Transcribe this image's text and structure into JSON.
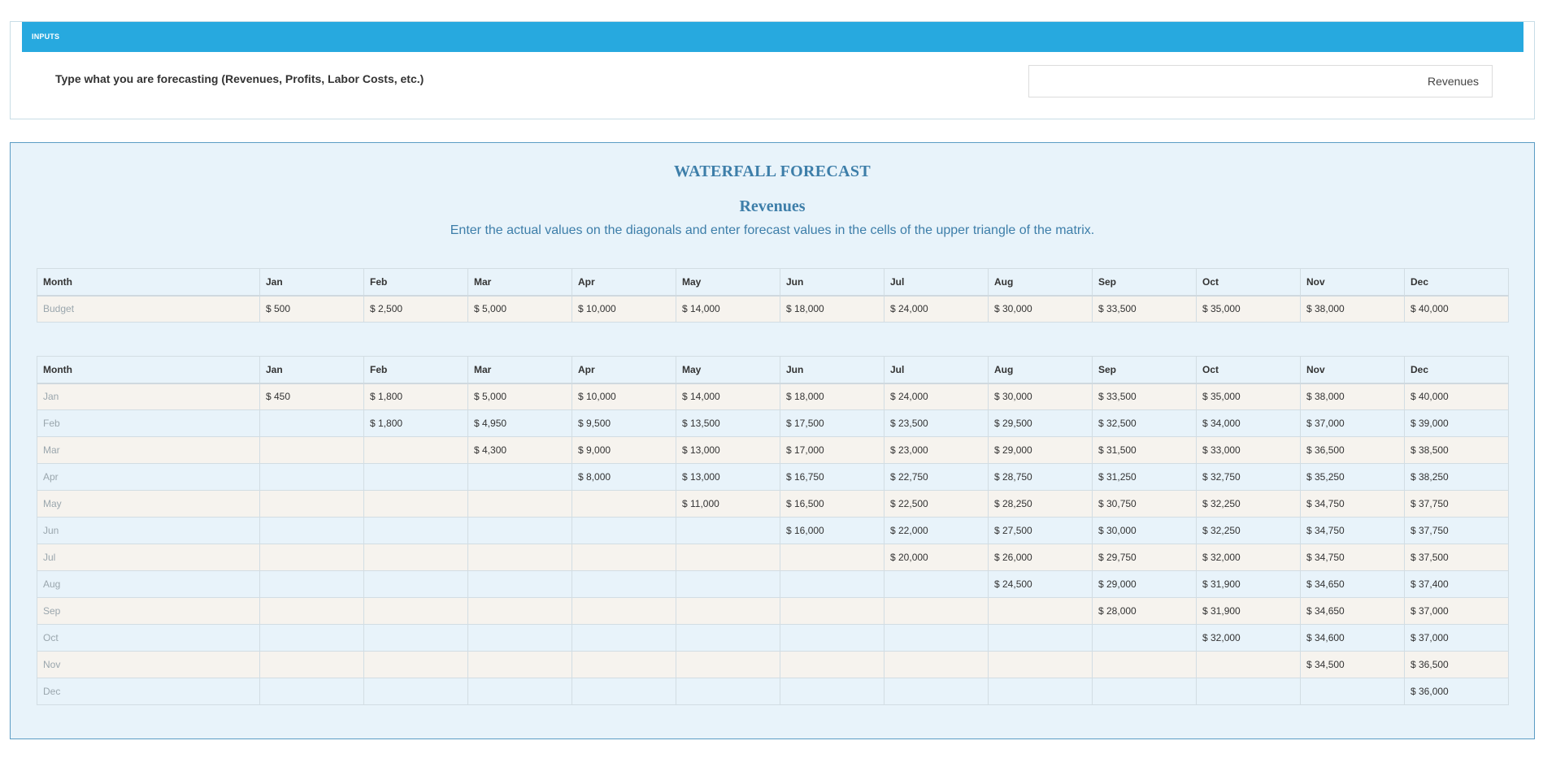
{
  "inputs": {
    "header": "INPUTS",
    "label": "Type what you are forecasting (Revenues, Profits, Labor Costs, etc.)",
    "value": "Revenues"
  },
  "forecast": {
    "title": "WATERFALL FORECAST",
    "subtitle": "Revenues",
    "instructions": "Enter the actual values on the diagonals and enter forecast values in the cells of the upper triangle of the matrix."
  },
  "budget_table": {
    "headers": [
      "Month",
      "Jan",
      "Feb",
      "Mar",
      "Apr",
      "May",
      "Jun",
      "Jul",
      "Aug",
      "Sep",
      "Oct",
      "Nov",
      "Dec"
    ],
    "rows": [
      [
        "Budget",
        "$ 500",
        "$ 2,500",
        "$ 5,000",
        "$ 10,000",
        "$ 14,000",
        "$ 18,000",
        "$ 24,000",
        "$ 30,000",
        "$ 33,500",
        "$ 35,000",
        "$ 38,000",
        "$ 40,000"
      ]
    ]
  },
  "matrix_table": {
    "headers": [
      "Month",
      "Jan",
      "Feb",
      "Mar",
      "Apr",
      "May",
      "Jun",
      "Jul",
      "Aug",
      "Sep",
      "Oct",
      "Nov",
      "Dec"
    ],
    "rows": [
      [
        "Jan",
        "$ 450",
        "$ 1,800",
        "$ 5,000",
        "$ 10,000",
        "$ 14,000",
        "$ 18,000",
        "$ 24,000",
        "$ 30,000",
        "$ 33,500",
        "$ 35,000",
        "$ 38,000",
        "$ 40,000"
      ],
      [
        "Feb",
        "",
        "$ 1,800",
        "$ 4,950",
        "$ 9,500",
        "$ 13,500",
        "$ 17,500",
        "$ 23,500",
        "$ 29,500",
        "$ 32,500",
        "$ 34,000",
        "$ 37,000",
        "$ 39,000"
      ],
      [
        "Mar",
        "",
        "",
        "$ 4,300",
        "$ 9,000",
        "$ 13,000",
        "$ 17,000",
        "$ 23,000",
        "$ 29,000",
        "$ 31,500",
        "$ 33,000",
        "$ 36,500",
        "$ 38,500"
      ],
      [
        "Apr",
        "",
        "",
        "",
        "$ 8,000",
        "$ 13,000",
        "$ 16,750",
        "$ 22,750",
        "$ 28,750",
        "$ 31,250",
        "$ 32,750",
        "$ 35,250",
        "$ 38,250"
      ],
      [
        "May",
        "",
        "",
        "",
        "",
        "$ 11,000",
        "$ 16,500",
        "$ 22,500",
        "$ 28,250",
        "$ 30,750",
        "$ 32,250",
        "$ 34,750",
        "$ 37,750"
      ],
      [
        "Jun",
        "",
        "",
        "",
        "",
        "",
        "$ 16,000",
        "$ 22,000",
        "$ 27,500",
        "$ 30,000",
        "$ 32,250",
        "$ 34,750",
        "$ 37,750"
      ],
      [
        "Jul",
        "",
        "",
        "",
        "",
        "",
        "",
        "$ 20,000",
        "$ 26,000",
        "$ 29,750",
        "$ 32,000",
        "$ 34,750",
        "$ 37,500"
      ],
      [
        "Aug",
        "",
        "",
        "",
        "",
        "",
        "",
        "",
        "$ 24,500",
        "$ 29,000",
        "$ 31,900",
        "$ 34,650",
        "$ 37,400"
      ],
      [
        "Sep",
        "",
        "",
        "",
        "",
        "",
        "",
        "",
        "",
        "$ 28,000",
        "$ 31,900",
        "$ 34,650",
        "$ 37,000"
      ],
      [
        "Oct",
        "",
        "",
        "",
        "",
        "",
        "",
        "",
        "",
        "",
        "$ 32,000",
        "$ 34,600",
        "$ 37,000"
      ],
      [
        "Nov",
        "",
        "",
        "",
        "",
        "",
        "",
        "",
        "",
        "",
        "",
        "$ 34,500",
        "$ 36,500"
      ],
      [
        "Dec",
        "",
        "",
        "",
        "",
        "",
        "",
        "",
        "",
        "",
        "",
        "",
        "$ 36,000"
      ]
    ]
  },
  "colors": {
    "header_blue": "#27a9df",
    "title_blue": "#3d7ea9",
    "panel_bg": "#e8f3fa",
    "row_alt_bg": "#f6f3ee"
  }
}
